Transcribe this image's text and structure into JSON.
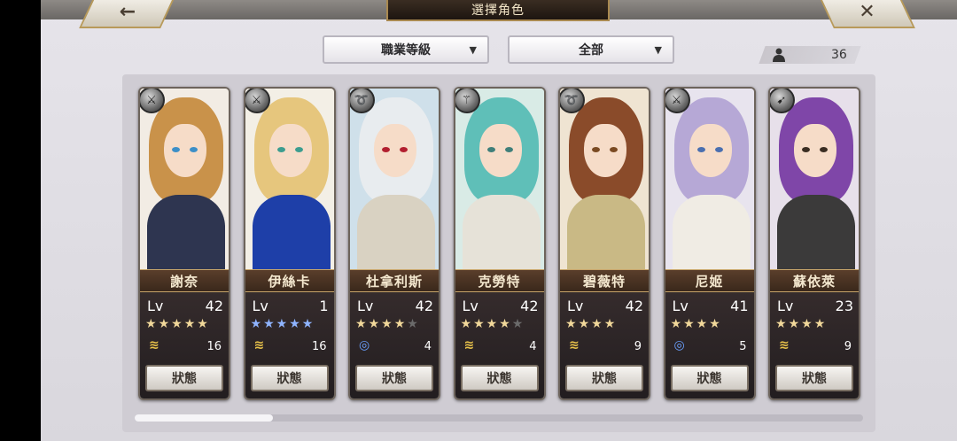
{
  "header": {
    "title": "選擇角色",
    "back_icon": "arrow-left-icon",
    "back_glyph": "←",
    "close_icon": "close-icon",
    "close_glyph": "✕"
  },
  "filters": {
    "job_level_label": "職業等級",
    "category_label": "全部",
    "dropdown_arrow": "▼"
  },
  "character_count": {
    "icon": "person-icon",
    "value": "36"
  },
  "status_button_label": "狀態",
  "level_label": "Lv",
  "characters": [
    {
      "name": "謝奈",
      "level": "42",
      "stars": 5,
      "star_style": "gold",
      "max_stars": 5,
      "element": "wind",
      "element_glyph": "≋",
      "count": "16",
      "class_glyph": "⚔"
    },
    {
      "name": "伊絲卡",
      "level": "1",
      "stars": 5,
      "star_style": "blue",
      "max_stars": 5,
      "element": "wind",
      "element_glyph": "≋",
      "count": "16",
      "class_glyph": "⚔"
    },
    {
      "name": "杜拿利斯",
      "level": "42",
      "stars": 4,
      "star_style": "gold",
      "max_stars": 5,
      "element": "water",
      "element_glyph": "◎",
      "count": "4",
      "class_glyph": "➰"
    },
    {
      "name": "克勞特",
      "level": "42",
      "stars": 4,
      "star_style": "gold",
      "max_stars": 5,
      "element": "wind",
      "element_glyph": "≋",
      "count": "4",
      "class_glyph": "⚚"
    },
    {
      "name": "碧薇特",
      "level": "42",
      "stars": 4,
      "star_style": "gold",
      "max_stars": 4,
      "element": "wind",
      "element_glyph": "≋",
      "count": "9",
      "class_glyph": "➰"
    },
    {
      "name": "尼姬",
      "level": "41",
      "stars": 4,
      "star_style": "gold",
      "max_stars": 4,
      "element": "water",
      "element_glyph": "◎",
      "count": "5",
      "class_glyph": "⚔"
    },
    {
      "name": "蘇依萊",
      "level": "23",
      "stars": 4,
      "star_style": "gold",
      "max_stars": 4,
      "element": "wind",
      "element_glyph": "≋",
      "count": "9",
      "class_glyph": "➹"
    }
  ],
  "portraits": [
    {
      "hair": "#c9924a",
      "outfit": "#2e3550",
      "eyes": "#3c8fc7",
      "bg": "#f2ece4"
    },
    {
      "hair": "#e6c67d",
      "outfit": "#1e3fa8",
      "eyes": "#3c9d8f",
      "bg": "#f3efe6"
    },
    {
      "hair": "#e8ecef",
      "outfit": "#d9d2c2",
      "eyes": "#b21f2f",
      "bg": "#cfe0ea"
    },
    {
      "hair": "#5fbfb8",
      "outfit": "#e6e2d8",
      "eyes": "#3f7f7a",
      "bg": "#d9ebe6"
    },
    {
      "hair": "#8a4b2a",
      "outfit": "#c9b985",
      "eyes": "#7a4a22",
      "bg": "#efe4d2"
    },
    {
      "hair": "#b6a8d6",
      "outfit": "#f0ece4",
      "eyes": "#4a6fb0",
      "bg": "#e8e4ee"
    },
    {
      "hair": "#7f46a8",
      "outfit": "#3b3a3a",
      "eyes": "#3a2d22",
      "bg": "#e7e0ea"
    }
  ],
  "scroll_position": 0.0
}
